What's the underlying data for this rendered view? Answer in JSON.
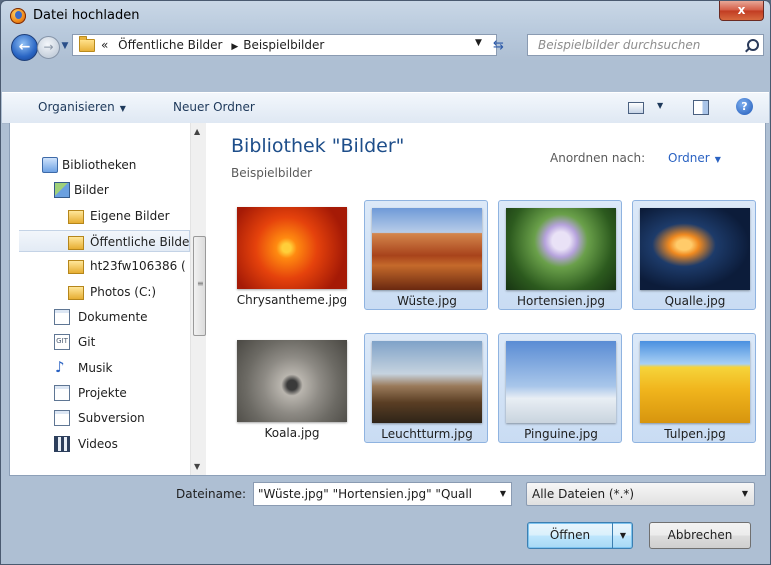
{
  "window": {
    "title": "Datei hochladen",
    "close_label": "x"
  },
  "navbar": {
    "back_glyph": "←",
    "forward_glyph": "→",
    "breadcrumb_prefix": "«",
    "breadcrumb": [
      "Öffentliche Bilder",
      "Beispielbilder"
    ],
    "search_placeholder": "Beispielbilder durchsuchen"
  },
  "toolbar": {
    "organize_label": "Organisieren",
    "new_folder_label": "Neuer Ordner",
    "help_glyph": "?"
  },
  "sidebar": {
    "items": [
      {
        "label": "Bibliotheken",
        "icon": "library-icon"
      },
      {
        "label": "Bilder",
        "icon": "pictures-icon"
      },
      {
        "label": "Eigene Bilder",
        "icon": "folder-icon"
      },
      {
        "label": "Öffentliche Bilder",
        "icon": "folder-icon",
        "selected": true
      },
      {
        "label": "ht23fw106386 (",
        "icon": "folder-icon"
      },
      {
        "label": "Photos (C:)",
        "icon": "folder-icon"
      },
      {
        "label": "Dokumente",
        "icon": "documents-icon"
      },
      {
        "label": "Git",
        "icon": "git-icon"
      },
      {
        "label": "Musik",
        "icon": "music-icon"
      },
      {
        "label": "Projekte",
        "icon": "documents-icon"
      },
      {
        "label": "Subversion",
        "icon": "documents-icon"
      },
      {
        "label": "Videos",
        "icon": "videos-icon"
      }
    ]
  },
  "library": {
    "title": "Bibliothek \"Bilder\"",
    "subtitle": "Beispielbilder",
    "arrange_label": "Anordnen nach:",
    "arrange_value": "Ordner"
  },
  "files": [
    {
      "name": "Chrysantheme.jpg",
      "selected": false
    },
    {
      "name": "Wüste.jpg",
      "selected": true
    },
    {
      "name": "Hortensien.jpg",
      "selected": true
    },
    {
      "name": "Qualle.jpg",
      "selected": true
    },
    {
      "name": "Koala.jpg",
      "selected": false
    },
    {
      "name": "Leuchtturm.jpg",
      "selected": true
    },
    {
      "name": "Pinguine.jpg",
      "selected": true
    },
    {
      "name": "Tulpen.jpg",
      "selected": true
    }
  ],
  "footer": {
    "filename_label": "Dateiname:",
    "filename_value": "\"Wüste.jpg\" \"Hortensien.jpg\" \"Quall",
    "filetype_value": "Alle Dateien (*.*)",
    "open_label": "Öffnen",
    "cancel_label": "Abbrechen"
  },
  "colors": {
    "accent": "#1e4e8a",
    "link": "#2a62c2",
    "selection": "#cfe0f5"
  }
}
